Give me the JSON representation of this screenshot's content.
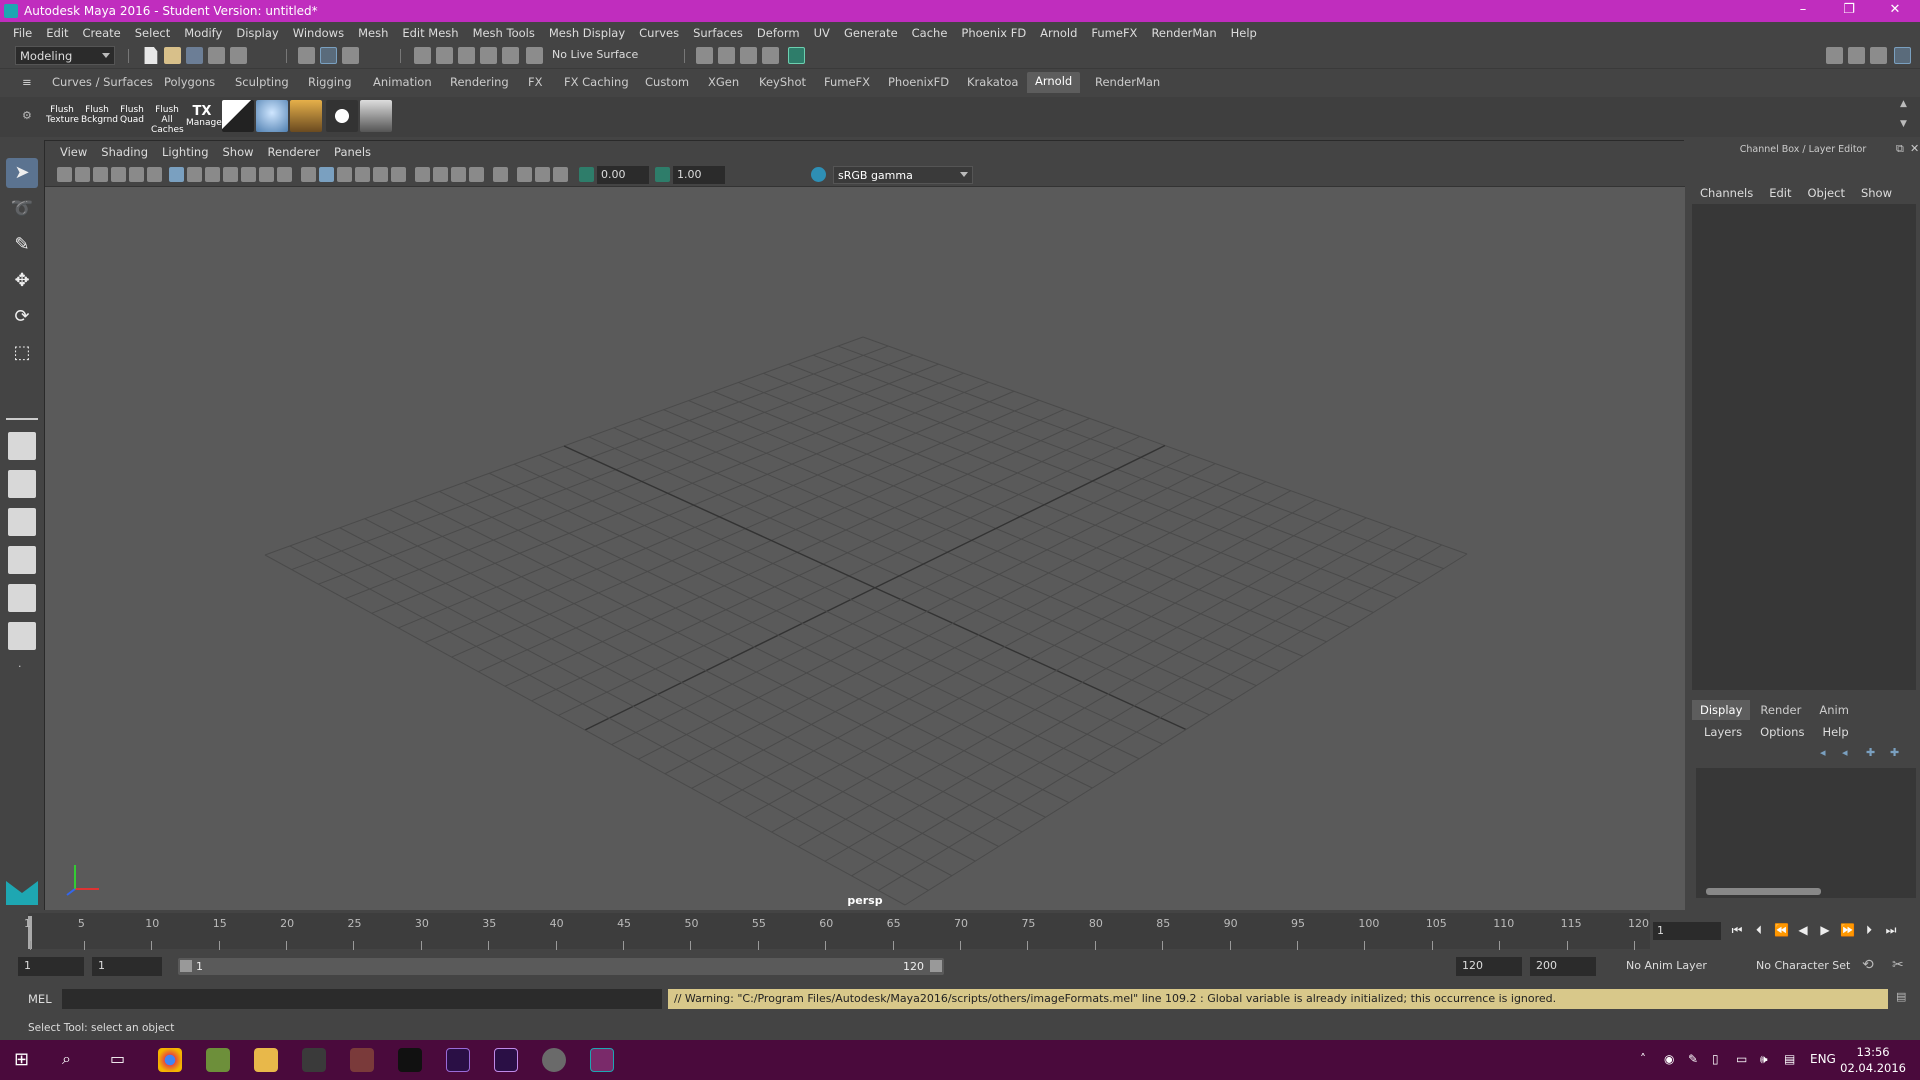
{
  "window": {
    "title": "Autodesk Maya 2016 - Student Version: untitled*",
    "minimize": "–",
    "restore": "❐",
    "close": "✕"
  },
  "menubar": [
    "File",
    "Edit",
    "Create",
    "Select",
    "Modify",
    "Display",
    "Windows",
    "Mesh",
    "Edit Mesh",
    "Mesh Tools",
    "Mesh Display",
    "Curves",
    "Surfaces",
    "Deform",
    "UV",
    "Generate",
    "Cache",
    "Phoenix FD",
    "Arnold",
    "FumeFX",
    "RenderMan",
    "Help"
  ],
  "status_line": {
    "mode": "Modeling",
    "live_surface": "No Live Surface"
  },
  "shelf_tabs": [
    "Curves / Surfaces",
    "Polygons",
    "Sculpting",
    "Rigging",
    "Animation",
    "Rendering",
    "FX",
    "FX Caching",
    "Custom",
    "XGen",
    "KeyShot",
    "FumeFX",
    "PhoenixFD",
    "Krakatoa",
    "Arnold",
    "RenderMan"
  ],
  "active_shelf_tab": "Arnold",
  "shelf_buttons": [
    {
      "line1": "Flush",
      "line2": "Texture"
    },
    {
      "line1": "Flush",
      "line2": "Bckgrnd"
    },
    {
      "line1": "Flush",
      "line2": "Quad"
    },
    {
      "line1": "Flush",
      "line2": "All Caches"
    },
    {
      "line1": "TX",
      "line2": "Manager"
    }
  ],
  "viewport": {
    "menu": [
      "View",
      "Shading",
      "Lighting",
      "Show",
      "Renderer",
      "Panels"
    ],
    "exposure": "0.00",
    "gamma": "1.00",
    "color_space": "sRGB gamma",
    "camera_label": "persp"
  },
  "channel_box": {
    "title": "Channel Box / Layer Editor",
    "menu": [
      "Channels",
      "Edit",
      "Object",
      "Show"
    ],
    "layer_tabs": [
      "Display",
      "Render",
      "Anim"
    ],
    "active_layer_tab": "Display",
    "layer_menu": [
      "Layers",
      "Options",
      "Help"
    ]
  },
  "timeline": {
    "ticks": [
      "1",
      "5",
      "10",
      "15",
      "20",
      "25",
      "30",
      "35",
      "40",
      "45",
      "50",
      "55",
      "60",
      "65",
      "70",
      "75",
      "80",
      "85",
      "90",
      "95",
      "100",
      "105",
      "110",
      "115",
      "120"
    ],
    "current_frame": "1"
  },
  "range": {
    "start": "1",
    "playback_start": "1",
    "slider_start": "1",
    "slider_end": "120",
    "playback_end": "120",
    "end": "200",
    "anim_layer": "No Anim Layer",
    "character_set": "No Character Set"
  },
  "command_line": {
    "label": "MEL",
    "warning": "// Warning: \"C:/Program Files/Autodesk/Maya2016/scripts/others/imageFormats.mel\" line 109.2 : Global variable is already initialized; this occurrence is ignored."
  },
  "help_line": "Select Tool: select an object",
  "taskbar": {
    "language": "ENG",
    "time": "13:56",
    "date": "02.04.2016"
  }
}
